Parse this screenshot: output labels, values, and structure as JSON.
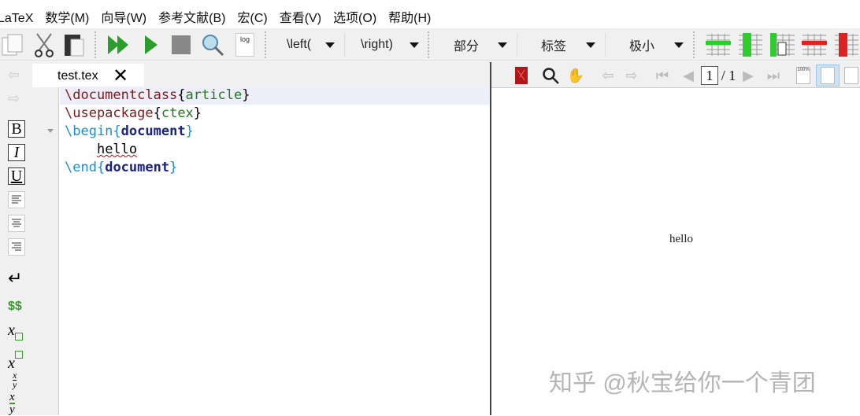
{
  "menu": [
    "LaTeX",
    "数学(M)",
    "向导(W)",
    "参考文献(B)",
    "宏(C)",
    "查看(V)",
    "选项(O)",
    "帮助(H)"
  ],
  "toolbar": {
    "left_paren": "\\left(",
    "right_paren": "\\right)",
    "section": "部分",
    "label": "标签",
    "size": "极小",
    "log_label": "log"
  },
  "tab": {
    "filename": "test.tex",
    "close": "✕"
  },
  "editor": {
    "lines": [
      {
        "cmd": "\\documentclass",
        "arg": "article"
      },
      {
        "cmd": "\\usepackage",
        "arg": "ctex"
      },
      {
        "cmd": "\\begin",
        "arg": "document"
      },
      {
        "text": "hello"
      },
      {
        "cmd": "\\end",
        "arg": "document"
      }
    ]
  },
  "leftbar": {
    "bold": "B",
    "italic": "I",
    "underline": "U",
    "math": "$$",
    "x": "x",
    "frac_num": "x",
    "frac_den": "y"
  },
  "preview": {
    "page_current": "1",
    "page_total": "/ 1",
    "zoom_icon_label": "100%",
    "content": "hello"
  },
  "watermark": "知乎 @秋宝给你一个青团"
}
